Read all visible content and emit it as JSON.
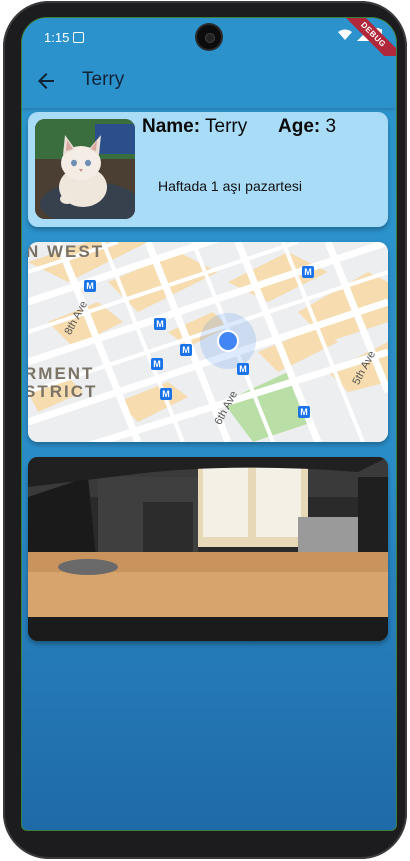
{
  "status": {
    "time": "1:15",
    "debug_label": "DEBUG"
  },
  "appbar": {
    "title": "Terry"
  },
  "pet": {
    "name_label": "Name:",
    "name": "Terry",
    "age_label": "Age:",
    "age": "3",
    "note": "Haftada 1 aşı pazartesi"
  },
  "map": {
    "labels": {
      "west": "N WEST",
      "district_1": "RMENT",
      "district_2": "STRICT"
    },
    "streets": [
      "8th Ave",
      "6th Ave",
      "5th Ave"
    ],
    "transit_marker": "M"
  },
  "colors": {
    "appbar": "#2b92cb",
    "card": "#a9dcf7",
    "location_dot": "#4285f4"
  }
}
